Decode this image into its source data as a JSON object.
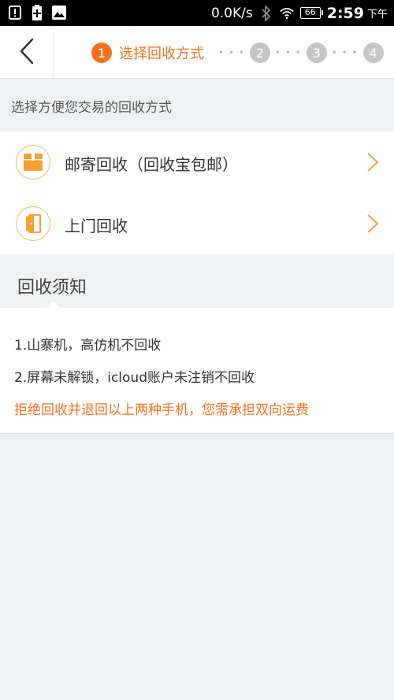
{
  "status_bar": {
    "icons": [
      "alert-icon",
      "battery-saver-icon",
      "image-icon"
    ],
    "speed": "0.0K/s",
    "battery": "66",
    "time": "2:59",
    "ampm": "下午"
  },
  "header": {
    "steps": [
      {
        "number": "1",
        "label": "选择回收方式",
        "active": true
      },
      {
        "number": "2",
        "active": false
      },
      {
        "number": "3",
        "active": false
      },
      {
        "number": "4",
        "active": false
      }
    ],
    "accent_color": "#f37021"
  },
  "intro_text": "选择方便您交易的回收方式",
  "options": [
    {
      "label": "邮寄回收（回收宝包邮）",
      "icon": "box-icon"
    },
    {
      "label": "上门回收",
      "icon": "door-icon"
    }
  ],
  "notice": {
    "title": "回收须知",
    "lines": [
      "1.山寨机，高仿机不回收",
      "2.屏幕未解锁，icloud账户未注销不回收"
    ],
    "warning": "拒绝回收并退回以上两种手机，您需承担双向运费"
  }
}
